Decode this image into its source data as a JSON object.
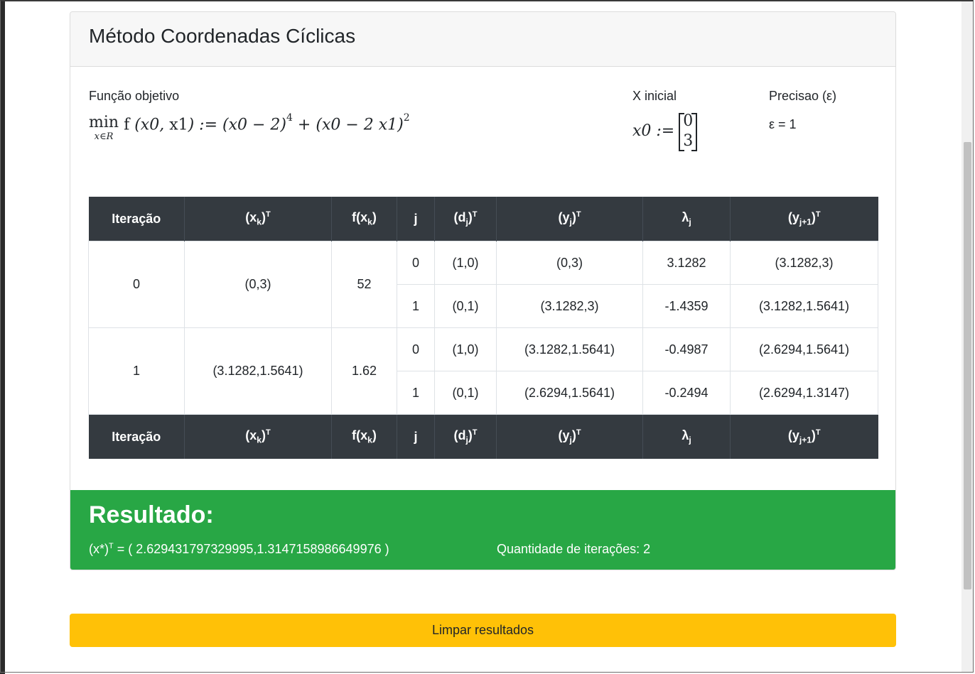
{
  "card": {
    "title": "Método Coordenadas Cíclicas",
    "objective_label": "Função objetivo",
    "initial_label": "X inicial",
    "precision_label": "Precisao (ε)",
    "precision_value": "ε = 1",
    "initial_vector": [
      "0",
      "3"
    ]
  },
  "table": {
    "headers": {
      "iteracao": "Iteração",
      "xk": "(x",
      "xk_sub": "k",
      "xk_sup": "T",
      "fxk": "f(x",
      "fxk_sub": "k",
      "fxk_end": ")",
      "j": "j",
      "dj": "(d",
      "dj_sub": "j",
      "dj_sup": "T",
      "yj": "(y",
      "yj_sub": "j",
      "yj_sup": "T",
      "lambda": "λ",
      "lambda_sub": "j",
      "yj1": "(y",
      "yj1_sub": "j+1",
      "yj1_sup": "T",
      "close": ")"
    },
    "rows": [
      {
        "iter": "0",
        "xk": "(0,3)",
        "fxk": "52",
        "sub": [
          {
            "j": "0",
            "dj": "(1,0)",
            "yj": "(0,3)",
            "lambda": "3.1282",
            "yj1": "(3.1282,3)"
          },
          {
            "j": "1",
            "dj": "(0,1)",
            "yj": "(3.1282,3)",
            "lambda": "-1.4359",
            "yj1": "(3.1282,1.5641)"
          }
        ]
      },
      {
        "iter": "1",
        "xk": "(3.1282,1.5641)",
        "fxk": "1.62",
        "sub": [
          {
            "j": "0",
            "dj": "(1,0)",
            "yj": "(3.1282,1.5641)",
            "lambda": "-0.4987",
            "yj1": "(2.6294,1.5641)"
          },
          {
            "j": "1",
            "dj": "(0,1)",
            "yj": "(2.6294,1.5641)",
            "lambda": "-0.2494",
            "yj1": "(2.6294,1.3147)"
          }
        ]
      }
    ]
  },
  "result": {
    "title": "Resultado:",
    "vector_prefix": "(x*)",
    "vector_sup": "T",
    "vector_value": " = ( 2.629431797329995,1.3147158986649976 )",
    "iterations": "Quantidade de iterações: 2"
  },
  "clear_button": "Limpar resultados",
  "colors": {
    "success": "#28a745",
    "warning": "#ffc107",
    "table_header": "#343a40"
  }
}
